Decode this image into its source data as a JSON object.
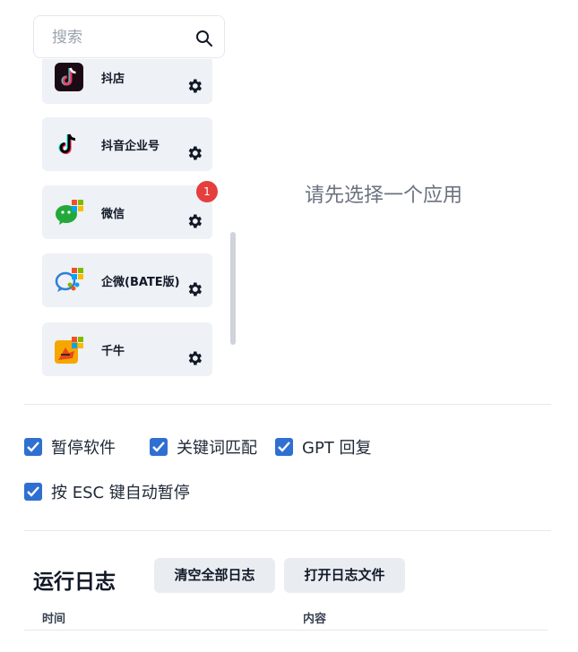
{
  "search": {
    "placeholder": "搜索"
  },
  "apps": [
    {
      "name": "抖店",
      "icon": "douyin-store-icon"
    },
    {
      "name": "抖音企业号",
      "icon": "douyin-icon"
    },
    {
      "name": "微信",
      "icon": "wechat-icon",
      "badge": "1"
    },
    {
      "name": "企微(BATE版)",
      "icon": "wecom-icon"
    },
    {
      "name": "千牛",
      "icon": "qianniu-icon"
    }
  ],
  "main": {
    "empty_hint": "请先选择一个应用"
  },
  "options": [
    {
      "label": "暂停软件",
      "checked": true
    },
    {
      "label": "关键词匹配",
      "checked": true
    },
    {
      "label": "GPT 回复",
      "checked": true
    },
    {
      "label": "按 ESC 键自动暂停",
      "checked": true
    }
  ],
  "log": {
    "title": "运行日志",
    "clear_label": "清空全部日志",
    "open_label": "打开日志文件",
    "columns": [
      "时间",
      "内容"
    ]
  },
  "colors": {
    "accent": "#2f6fd1",
    "badge": "#e53e3e",
    "card": "#eef1f5"
  }
}
